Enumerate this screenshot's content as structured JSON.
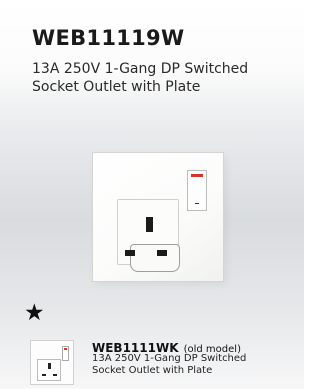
{
  "product": {
    "code": "WEB11119W",
    "description_line1": "13A 250V 1-Gang DP Switched",
    "description_line2": "Socket Outlet with Plate"
  },
  "marker": {
    "symbol": "★"
  },
  "old_model": {
    "code": "WEB1111WK",
    "note": "(old model)",
    "description_line1": "13A 250V 1-Gang DP Switched",
    "description_line2": "Socket Outlet with Plate"
  },
  "colors": {
    "indicator_red": "#d4352a",
    "plate_white": "#fdfdfd",
    "background_grey": "#d9dcdf"
  }
}
